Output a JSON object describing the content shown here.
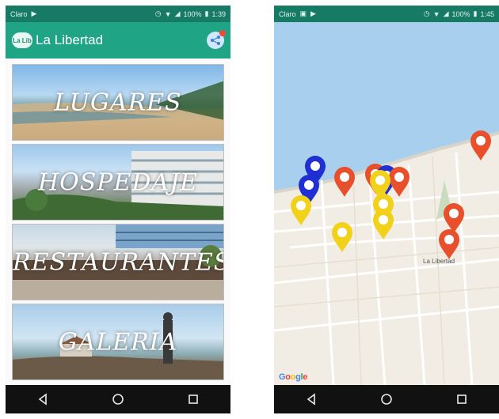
{
  "left_screen": {
    "status": {
      "carrier": "Claro",
      "right_text": "100%",
      "time": "1:39"
    },
    "app_title": "La Libertad",
    "logo_text": "La Lib",
    "tiles": [
      {
        "label": "LUGARES"
      },
      {
        "label": "HOSPEDAJE"
      },
      {
        "label": "RESTAURANTES"
      },
      {
        "label": "GALERIA"
      }
    ]
  },
  "right_screen": {
    "status": {
      "carrier": "Claro",
      "right_text": "100%",
      "time": "1:45"
    },
    "map": {
      "place_label": "La Libertad",
      "attribution": "Google",
      "pin_colors": {
        "red": "#e8502c",
        "blue": "#1f2fd1",
        "yellow": "#f2d11b"
      },
      "pins": [
        {
          "color": "blue"
        },
        {
          "color": "blue"
        },
        {
          "color": "red"
        },
        {
          "color": "red"
        },
        {
          "color": "blue"
        },
        {
          "color": "red"
        },
        {
          "color": "yellow"
        },
        {
          "color": "yellow"
        },
        {
          "color": "yellow"
        },
        {
          "color": "yellow"
        },
        {
          "color": "yellow"
        },
        {
          "color": "red"
        },
        {
          "color": "red"
        },
        {
          "color": "red"
        }
      ]
    }
  },
  "navigation": {
    "back": "back-icon",
    "home": "home-icon",
    "recents": "recents-icon"
  }
}
